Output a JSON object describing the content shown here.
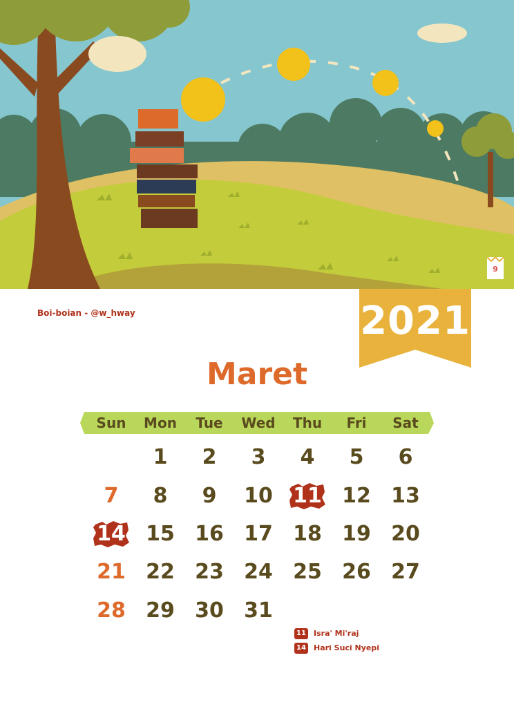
{
  "page_number": "9",
  "credit": "Boi-boian - @w_hway",
  "year": "2021",
  "month": "Maret",
  "weekdays": [
    "Sun",
    "Mon",
    "Tue",
    "Wed",
    "Thu",
    "Fri",
    "Sat"
  ],
  "days": [
    "1",
    "2",
    "3",
    "4",
    "5",
    "6",
    "7",
    "8",
    "9",
    "10",
    "11",
    "12",
    "13",
    "14",
    "15",
    "16",
    "17",
    "18",
    "19",
    "20",
    "21",
    "22",
    "23",
    "24",
    "25",
    "26",
    "27",
    "28",
    "29",
    "30",
    "31"
  ],
  "holidays": [
    {
      "day": "11",
      "name": "Isra' Mi'raj"
    },
    {
      "day": "14",
      "name": "Hari Suci Nyepi"
    }
  ],
  "colors": {
    "sky": "#86c6cf",
    "grass": "#c3cc3a",
    "ribbon": "#e8b23c",
    "weekday_band": "#b9d75a",
    "holiday": "#b0321b",
    "sunday": "#dd6a2a",
    "text": "#5a4b1f"
  }
}
